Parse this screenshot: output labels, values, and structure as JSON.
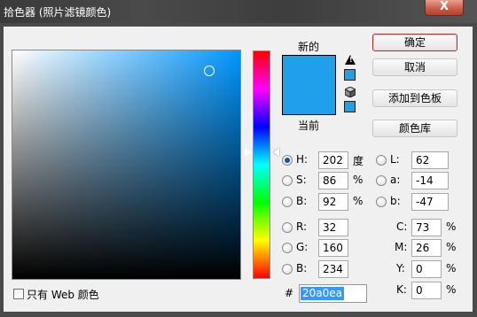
{
  "window": {
    "title": "拾色器 (照片滤镜颜色)",
    "close_label": "X"
  },
  "swatch": {
    "new_label": "新的",
    "current_label": "当前",
    "color": "#20a0ea"
  },
  "buttons": {
    "ok": "确定",
    "cancel": "取消",
    "add_to_swatches": "添加到色板",
    "color_libraries": "颜色库"
  },
  "hsb": {
    "h": {
      "label": "H:",
      "value": "202",
      "unit": "度",
      "selected": true
    },
    "s": {
      "label": "S:",
      "value": "86",
      "unit": "%"
    },
    "b": {
      "label": "B:",
      "value": "92",
      "unit": "%"
    }
  },
  "lab": {
    "l": {
      "label": "L:",
      "value": "62"
    },
    "a": {
      "label": "a:",
      "value": "-14"
    },
    "b": {
      "label": "b:",
      "value": "-47"
    }
  },
  "rgb": {
    "r": {
      "label": "R:",
      "value": "32"
    },
    "g": {
      "label": "G:",
      "value": "160"
    },
    "b": {
      "label": "B:",
      "value": "234"
    }
  },
  "cmyk": {
    "c": {
      "label": "C:",
      "value": "73",
      "unit": "%"
    },
    "m": {
      "label": "M:",
      "value": "26",
      "unit": "%"
    },
    "y": {
      "label": "Y:",
      "value": "0",
      "unit": "%"
    },
    "k": {
      "label": "K:",
      "value": "0",
      "unit": "%"
    }
  },
  "hex": {
    "label": "#",
    "value": "20a0ea"
  },
  "web_only": {
    "label": "只有 Web 颜色",
    "checked": false
  },
  "icons": [
    "warning-icon",
    "cube-icon",
    "close-icon"
  ],
  "colors": {
    "current": "#20a0ea",
    "button_border": "#aa3333",
    "hex_selection": "#3399ff"
  }
}
